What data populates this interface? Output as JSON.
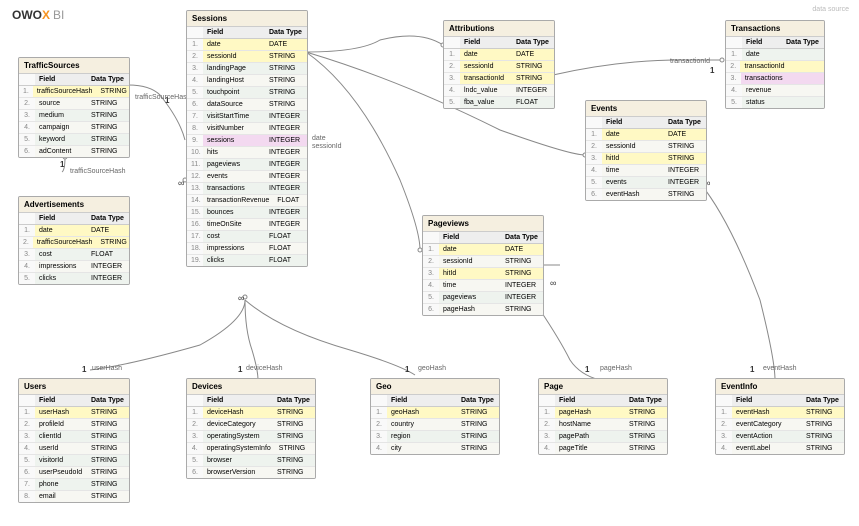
{
  "brand": {
    "o": "OWO",
    "x": "X",
    "bi": "BI"
  },
  "dataSourceLabel": "data source",
  "headers": {
    "field": "Field",
    "dataType": "Data Type"
  },
  "tables": {
    "trafficSources": {
      "title": "TrafficSources",
      "rows": [
        {
          "n": "1.",
          "f": "trafficSourceHash",
          "t": "STRING",
          "hl": "y"
        },
        {
          "n": "2.",
          "f": "source",
          "t": "STRING"
        },
        {
          "n": "3.",
          "f": "medium",
          "t": "STRING"
        },
        {
          "n": "4.",
          "f": "campaign",
          "t": "STRING"
        },
        {
          "n": "5.",
          "f": "keyword",
          "t": "STRING"
        },
        {
          "n": "6.",
          "f": "adContent",
          "t": "STRING"
        }
      ]
    },
    "advertisements": {
      "title": "Advertisements",
      "rows": [
        {
          "n": "1.",
          "f": "date",
          "t": "DATE",
          "hl": "y"
        },
        {
          "n": "2.",
          "f": "trafficSourceHash",
          "t": "STRING",
          "hl": "y"
        },
        {
          "n": "3.",
          "f": "cost",
          "t": "FLOAT"
        },
        {
          "n": "4.",
          "f": "impressions",
          "t": "INTEGER"
        },
        {
          "n": "5.",
          "f": "clicks",
          "t": "INTEGER"
        }
      ]
    },
    "sessions": {
      "title": "Sessions",
      "rows": [
        {
          "n": "1.",
          "f": "date",
          "t": "DATE",
          "hl": "y"
        },
        {
          "n": "2.",
          "f": "sessionId",
          "t": "STRING",
          "hl": "y"
        },
        {
          "n": "3.",
          "f": "landingPage",
          "t": "STRING"
        },
        {
          "n": "4.",
          "f": "landingHost",
          "t": "STRING"
        },
        {
          "n": "5.",
          "f": "touchpoint",
          "t": "STRING"
        },
        {
          "n": "6.",
          "f": "dataSource",
          "t": "STRING"
        },
        {
          "n": "7.",
          "f": "visitStartTime",
          "t": "INTEGER"
        },
        {
          "n": "8.",
          "f": "visitNumber",
          "t": "INTEGER"
        },
        {
          "n": "9.",
          "f": "sessions",
          "t": "INTEGER",
          "hl": "p"
        },
        {
          "n": "10.",
          "f": "hits",
          "t": "INTEGER"
        },
        {
          "n": "11.",
          "f": "pageviews",
          "t": "INTEGER"
        },
        {
          "n": "12.",
          "f": "events",
          "t": "INTEGER"
        },
        {
          "n": "13.",
          "f": "transactions",
          "t": "INTEGER"
        },
        {
          "n": "14.",
          "f": "transactionRevenue",
          "t": "FLOAT"
        },
        {
          "n": "15.",
          "f": "bounces",
          "t": "INTEGER"
        },
        {
          "n": "16.",
          "f": "timeOnSite",
          "t": "INTEGER"
        },
        {
          "n": "17.",
          "f": "cost",
          "t": "FLOAT"
        },
        {
          "n": "18.",
          "f": "impressions",
          "t": "FLOAT"
        },
        {
          "n": "19.",
          "f": "clicks",
          "t": "FLOAT"
        }
      ]
    },
    "attributions": {
      "title": "Attributions",
      "rows": [
        {
          "n": "1.",
          "f": "date",
          "t": "DATE",
          "hl": "y"
        },
        {
          "n": "2.",
          "f": "sessionId",
          "t": "STRING",
          "hl": "y"
        },
        {
          "n": "3.",
          "f": "transactionId",
          "t": "STRING",
          "hl": "y"
        },
        {
          "n": "4.",
          "f": "lndc_value",
          "t": "INTEGER"
        },
        {
          "n": "5.",
          "f": "fba_value",
          "t": "FLOAT"
        }
      ]
    },
    "events": {
      "title": "Events",
      "rows": [
        {
          "n": "1.",
          "f": "date",
          "t": "DATE",
          "hl": "y"
        },
        {
          "n": "2.",
          "f": "sessionId",
          "t": "STRING"
        },
        {
          "n": "3.",
          "f": "hitId",
          "t": "STRING",
          "hl": "y"
        },
        {
          "n": "4.",
          "f": "time",
          "t": "INTEGER"
        },
        {
          "n": "5.",
          "f": "events",
          "t": "INTEGER"
        },
        {
          "n": "6.",
          "f": "eventHash",
          "t": "STRING"
        }
      ]
    },
    "transactions": {
      "title": "Transactions",
      "rows": [
        {
          "n": "1.",
          "f": "date",
          "t": ""
        },
        {
          "n": "2.",
          "f": "transactionId",
          "t": "",
          "hl": "y"
        },
        {
          "n": "3.",
          "f": "transactions",
          "t": "",
          "hl": "p"
        },
        {
          "n": "4.",
          "f": "revenue",
          "t": ""
        },
        {
          "n": "5.",
          "f": "status",
          "t": ""
        }
      ]
    },
    "pageviews": {
      "title": "Pageviews",
      "rows": [
        {
          "n": "1.",
          "f": "date",
          "t": "DATE",
          "hl": "y"
        },
        {
          "n": "2.",
          "f": "sessionId",
          "t": "STRING"
        },
        {
          "n": "3.",
          "f": "hitId",
          "t": "STRING",
          "hl": "y"
        },
        {
          "n": "4.",
          "f": "time",
          "t": "INTEGER"
        },
        {
          "n": "5.",
          "f": "pageviews",
          "t": "INTEGER"
        },
        {
          "n": "6.",
          "f": "pageHash",
          "t": "STRING"
        }
      ]
    },
    "users": {
      "title": "Users",
      "rows": [
        {
          "n": "1.",
          "f": "userHash",
          "t": "STRING",
          "hl": "y"
        },
        {
          "n": "2.",
          "f": "profileId",
          "t": "STRING"
        },
        {
          "n": "3.",
          "f": "clientId",
          "t": "STRING"
        },
        {
          "n": "4.",
          "f": "userId",
          "t": "STRING"
        },
        {
          "n": "5.",
          "f": "visitorId",
          "t": "STRING"
        },
        {
          "n": "6.",
          "f": "userPseudoId",
          "t": "STRING"
        },
        {
          "n": "7.",
          "f": "phone",
          "t": "STRING"
        },
        {
          "n": "8.",
          "f": "email",
          "t": "STRING"
        }
      ]
    },
    "devices": {
      "title": "Devices",
      "rows": [
        {
          "n": "1.",
          "f": "deviceHash",
          "t": "STRING",
          "hl": "y"
        },
        {
          "n": "2.",
          "f": "deviceCategory",
          "t": "STRING"
        },
        {
          "n": "3.",
          "f": "operatingSystem",
          "t": "STRING"
        },
        {
          "n": "4.",
          "f": "operatingSystemInfo",
          "t": "STRING"
        },
        {
          "n": "5.",
          "f": "browser",
          "t": "STRING"
        },
        {
          "n": "6.",
          "f": "browserVersion",
          "t": "STRING"
        }
      ]
    },
    "geo": {
      "title": "Geo",
      "rows": [
        {
          "n": "1.",
          "f": "geoHash",
          "t": "STRING",
          "hl": "y"
        },
        {
          "n": "2.",
          "f": "country",
          "t": "STRING"
        },
        {
          "n": "3.",
          "f": "region",
          "t": "STRING"
        },
        {
          "n": "4.",
          "f": "city",
          "t": "STRING"
        }
      ]
    },
    "page": {
      "title": "Page",
      "rows": [
        {
          "n": "1.",
          "f": "pageHash",
          "t": "STRING",
          "hl": "y"
        },
        {
          "n": "2.",
          "f": "hostName",
          "t": "STRING"
        },
        {
          "n": "3.",
          "f": "pagePath",
          "t": "STRING"
        },
        {
          "n": "4.",
          "f": "pageTitle",
          "t": "STRING"
        }
      ]
    },
    "eventInfo": {
      "title": "EventInfo",
      "rows": [
        {
          "n": "1.",
          "f": "eventHash",
          "t": "STRING",
          "hl": "y"
        },
        {
          "n": "2.",
          "f": "eventCategory",
          "t": "STRING"
        },
        {
          "n": "3.",
          "f": "eventAction",
          "t": "STRING"
        },
        {
          "n": "4.",
          "f": "eventLabel",
          "t": "STRING"
        }
      ]
    }
  },
  "labels": {
    "trafficSourceHash": "trafficSourceHash",
    "date": "date",
    "sessionId": "sessionId",
    "userHash": "userHash",
    "deviceHash": "deviceHash",
    "geoHash": "geoHash",
    "pageHash": "pageHash",
    "eventHash": "eventHash",
    "transactionId": "transactionId"
  },
  "card": {
    "one": "1",
    "inf": "∞"
  }
}
